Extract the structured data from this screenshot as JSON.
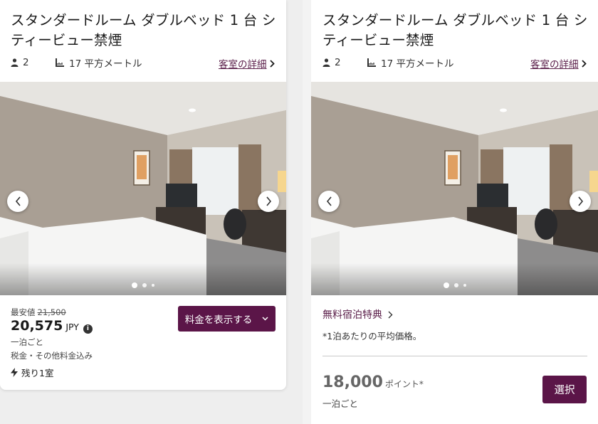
{
  "room": {
    "title": "スタンダードルーム ダブルベッド 1 台 シティービュー禁煙",
    "guests": "2",
    "size": "17 平方メートル",
    "details_link": "客室の詳細"
  },
  "left_card": {
    "min_price_label": "最安値",
    "original_price": "21,500",
    "price": "20,575",
    "currency": "JPY",
    "per_night": "一泊ごと",
    "tax_note": "税金・その他料金込み",
    "remaining": "残り1室",
    "show_rates_button": "料金を表示する"
  },
  "right_card": {
    "free_night_link": "無料宿泊特典",
    "avg_note": "*1泊あたりの平均価格。",
    "points": "18,000",
    "points_label": "ポイント*",
    "per_night": "一泊ごと",
    "select_button": "選択"
  },
  "icons": {
    "guests": "person-icon",
    "size": "floor-area-icon",
    "details": "chevron-right-icon",
    "prev": "chevron-left-icon",
    "next": "chevron-right-icon",
    "info": "info-icon",
    "urgency": "lightning-icon",
    "dropdown": "chevron-down-icon"
  },
  "colors": {
    "brand": "#5b1548",
    "link": "#5b1f4a"
  }
}
